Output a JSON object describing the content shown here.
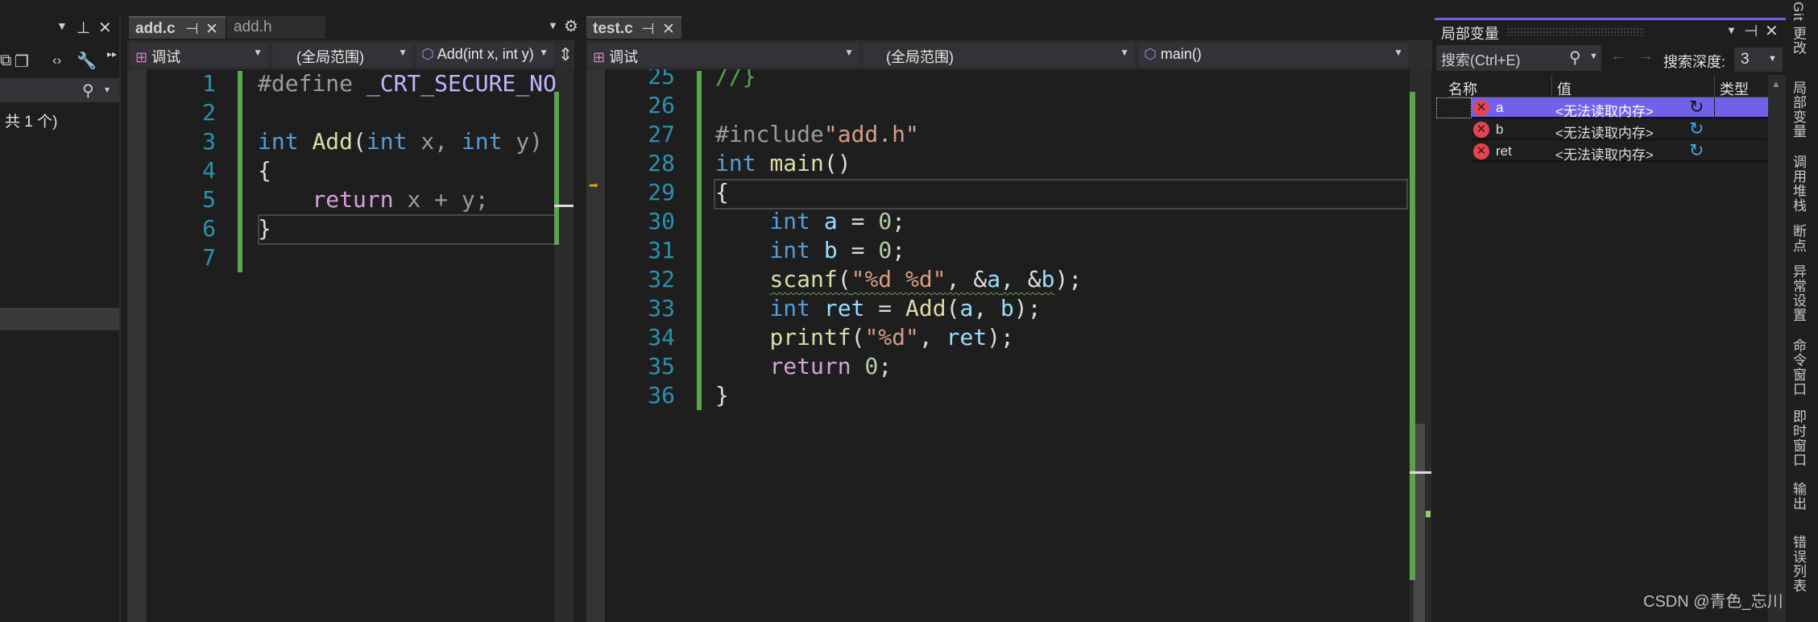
{
  "left_panel": {
    "summary": "共 1 个)"
  },
  "editor1": {
    "tabs": [
      {
        "label": "add.c",
        "active": true
      },
      {
        "label": "add.h",
        "active": false
      }
    ],
    "dropdowns": {
      "project": "调试",
      "scope": "(全局范围)",
      "member": "Add(int x, int y)"
    },
    "lines": [
      {
        "num": "1",
        "tokens": [
          {
            "t": "#define ",
            "c": "pp"
          },
          {
            "t": "_CRT_SECURE_NO",
            "c": "mac"
          }
        ]
      },
      {
        "num": "2",
        "tokens": []
      },
      {
        "num": "3",
        "tokens": [
          {
            "t": "int ",
            "c": "kw"
          },
          {
            "t": "Add",
            "c": "fn"
          },
          {
            "t": "(",
            "c": "pl"
          },
          {
            "t": "int ",
            "c": "kw"
          },
          {
            "t": "x, ",
            "c": "prm"
          },
          {
            "t": "int ",
            "c": "kw"
          },
          {
            "t": "y)",
            "c": "prm"
          }
        ]
      },
      {
        "num": "4",
        "tokens": [
          {
            "t": "{",
            "c": "pl"
          }
        ]
      },
      {
        "num": "5",
        "tokens": [
          {
            "t": "    ",
            "c": "pl"
          },
          {
            "t": "return ",
            "c": "ctl"
          },
          {
            "t": "x + y;",
            "c": "prm"
          }
        ]
      },
      {
        "num": "6",
        "tokens": [
          {
            "t": "}",
            "c": "pl"
          }
        ]
      },
      {
        "num": "7",
        "tokens": []
      }
    ]
  },
  "editor2": {
    "tabs": [
      {
        "label": "test.c",
        "active": true
      }
    ],
    "dropdowns": {
      "project": "调试",
      "scope": "(全局范围)",
      "member": "main()"
    },
    "lines": [
      {
        "num": "25",
        "tokens": [
          {
            "t": "//}",
            "c": "cm"
          }
        ]
      },
      {
        "num": "26",
        "tokens": []
      },
      {
        "num": "27",
        "tokens": [
          {
            "t": "#include",
            "c": "pp"
          },
          {
            "t": "\"add.h\"",
            "c": "str"
          }
        ]
      },
      {
        "num": "28",
        "tokens": [
          {
            "t": "int ",
            "c": "kw"
          },
          {
            "t": "main",
            "c": "fn"
          },
          {
            "t": "()",
            "c": "pl"
          }
        ]
      },
      {
        "num": "29",
        "tokens": [
          {
            "t": "{",
            "c": "pl"
          }
        ]
      },
      {
        "num": "30",
        "tokens": [
          {
            "t": "    ",
            "c": "pl"
          },
          {
            "t": "int ",
            "c": "kw"
          },
          {
            "t": "a",
            "c": "var"
          },
          {
            "t": " = ",
            "c": "pl"
          },
          {
            "t": "0",
            "c": "num"
          },
          {
            "t": ";",
            "c": "pl"
          }
        ]
      },
      {
        "num": "31",
        "tokens": [
          {
            "t": "    ",
            "c": "pl"
          },
          {
            "t": "int ",
            "c": "kw"
          },
          {
            "t": "b",
            "c": "var"
          },
          {
            "t": " = ",
            "c": "pl"
          },
          {
            "t": "0",
            "c": "num"
          },
          {
            "t": ";",
            "c": "pl"
          }
        ]
      },
      {
        "num": "32",
        "tokens": [
          {
            "t": "    ",
            "c": "pl"
          },
          {
            "t": "scanf",
            "c": "fn squig"
          },
          {
            "t": "(",
            "c": "pl squig"
          },
          {
            "t": "\"%d %d\"",
            "c": "str squig"
          },
          {
            "t": ", &",
            "c": "pl squig"
          },
          {
            "t": "a",
            "c": "var squig"
          },
          {
            "t": ", &",
            "c": "pl squig"
          },
          {
            "t": "b",
            "c": "var squig"
          },
          {
            "t": ");",
            "c": "pl"
          }
        ]
      },
      {
        "num": "33",
        "tokens": [
          {
            "t": "    ",
            "c": "pl"
          },
          {
            "t": "int ",
            "c": "kw"
          },
          {
            "t": "ret",
            "c": "var"
          },
          {
            "t": " = ",
            "c": "pl"
          },
          {
            "t": "Add",
            "c": "fn"
          },
          {
            "t": "(",
            "c": "pl"
          },
          {
            "t": "a",
            "c": "var"
          },
          {
            "t": ", ",
            "c": "pl"
          },
          {
            "t": "b",
            "c": "var"
          },
          {
            "t": ");",
            "c": "pl"
          }
        ]
      },
      {
        "num": "34",
        "tokens": [
          {
            "t": "    ",
            "c": "pl"
          },
          {
            "t": "printf",
            "c": "fn"
          },
          {
            "t": "(",
            "c": "pl"
          },
          {
            "t": "\"%d\"",
            "c": "str"
          },
          {
            "t": ", ",
            "c": "pl"
          },
          {
            "t": "ret",
            "c": "var"
          },
          {
            "t": ");",
            "c": "pl"
          }
        ]
      },
      {
        "num": "35",
        "tokens": [
          {
            "t": "    ",
            "c": "pl"
          },
          {
            "t": "return ",
            "c": "ctl"
          },
          {
            "t": "0",
            "c": "num"
          },
          {
            "t": ";",
            "c": "pl"
          }
        ]
      },
      {
        "num": "36",
        "tokens": [
          {
            "t": "}",
            "c": "pl"
          }
        ]
      }
    ]
  },
  "locals": {
    "title": "局部变量",
    "search_placeholder": "搜索(Ctrl+E)",
    "depth_label": "搜索深度:",
    "depth_value": "3",
    "columns": {
      "name": "名称",
      "value": "值",
      "type": "类型"
    },
    "rows": [
      {
        "name": "a",
        "value": "<无法读取内存>",
        "type": ""
      },
      {
        "name": "b",
        "value": "<无法读取内存>",
        "type": ""
      },
      {
        "name": "ret",
        "value": "<无法读取内存>",
        "type": ""
      }
    ]
  },
  "side_tabs": [
    "Git 更改",
    "局部变量",
    "调用堆栈",
    "断点",
    "异常设置",
    "命令窗口",
    "即时窗口",
    "输出",
    "错误列表"
  ],
  "watermark": "CSDN @青色_忘川",
  "colors": {
    "accent": "#7160e8",
    "change_bar": "#57a64a",
    "line_number": "#2b91af"
  }
}
